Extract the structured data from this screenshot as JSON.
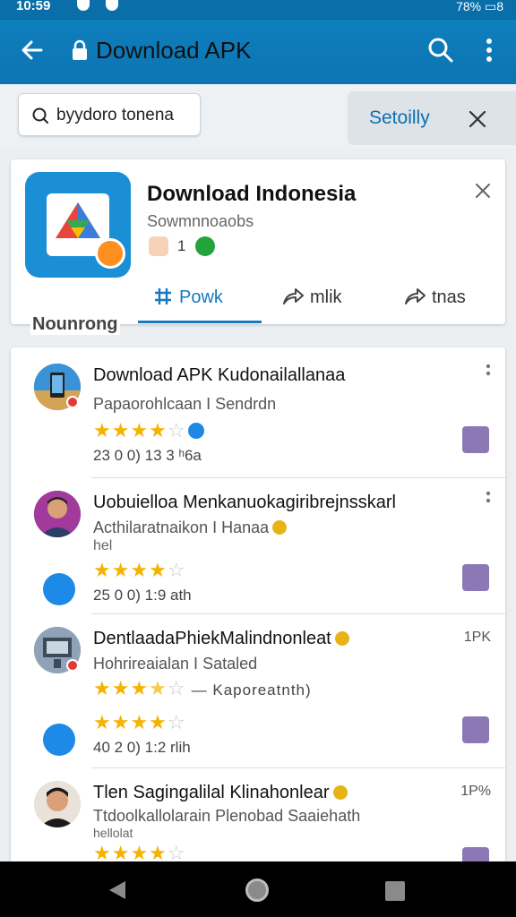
{
  "status_bar": {
    "time": "10:59",
    "right": "78% ▭8"
  },
  "app_bar": {
    "title": "Download APK"
  },
  "search": {
    "value": "byydoro tonena"
  },
  "filter": {
    "label": "Setoilly"
  },
  "app": {
    "name": "Download Indonesia",
    "developer": "Sowmnnoaobs",
    "rating_count": "1",
    "tabs": [
      {
        "label": "Powk",
        "icon": "grid-icon"
      },
      {
        "label": "mlik",
        "icon": "share-icon"
      },
      {
        "label": "tnas",
        "icon": "share-icon"
      }
    ]
  },
  "section": {
    "label": "Nounrong"
  },
  "list": [
    {
      "title": "Download APK Kudonailallanaa",
      "subtitle": "Papaorohlcaan I Sendrdn",
      "rating": 4,
      "meta": "23 0 0)  13 3  ʰ6a",
      "size": ""
    },
    {
      "title": "Uobuielloa Menkanuokagiribrejnsskarl",
      "subtitle": "Acthilaratnaikon I Hanaa",
      "subtitle2": "hel",
      "rating": 4,
      "meta": "25 0 0)  1:9  ath",
      "size": ""
    },
    {
      "title": "DentlaadaPhiekMalindnonleat",
      "subtitle": "Hohrireaialan I Sataled",
      "rating": 3.5,
      "extra": "— Kaporeatnth)",
      "rating2": 4,
      "meta": "40 2 0)  1:2  rlih",
      "size": "1PK"
    },
    {
      "title": "Tlen Sagingalilal Klinahonlear",
      "subtitle": "Ttdoolkallolarain Plenobad Saaiehath",
      "subtitle2": "hellolat",
      "rating": 4,
      "meta": "",
      "size": "1P%"
    }
  ],
  "colors": {
    "accent": "#0c74b1",
    "star": "#f5b301",
    "link": "#1479c0"
  }
}
